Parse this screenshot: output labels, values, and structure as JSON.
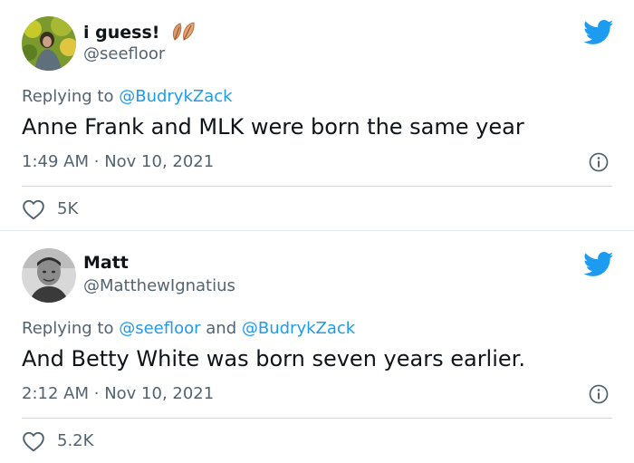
{
  "tweets": [
    {
      "display_name": "i guess!",
      "handle": "@seefloor",
      "reply_prefix": "Replying to",
      "reply_mentions": [
        "@BudrykZack"
      ],
      "text": "Anne Frank and MLK were born the same year",
      "time": "1:49 AM",
      "date": "Nov 10, 2021",
      "likes": "5K",
      "avatar_icon": "avatar-photo-outdoor",
      "name_emoji": "leaves-icon"
    },
    {
      "display_name": "Matt",
      "handle": "@MatthewIgnatius",
      "reply_prefix": "Replying to",
      "reply_mentions": [
        "@seefloor",
        "@BudrykZack"
      ],
      "reply_joiner": "and",
      "text": "And Betty White was born seven years earlier.",
      "time": "2:12 AM",
      "date": "Nov 10, 2021",
      "likes": "5.2K",
      "avatar_icon": "avatar-photo-bw"
    }
  ],
  "separator": "·",
  "colors": {
    "brand": "#1d9bf0",
    "text": "#0f1419",
    "secondary": "#536471",
    "divider": "#cfd9de"
  }
}
